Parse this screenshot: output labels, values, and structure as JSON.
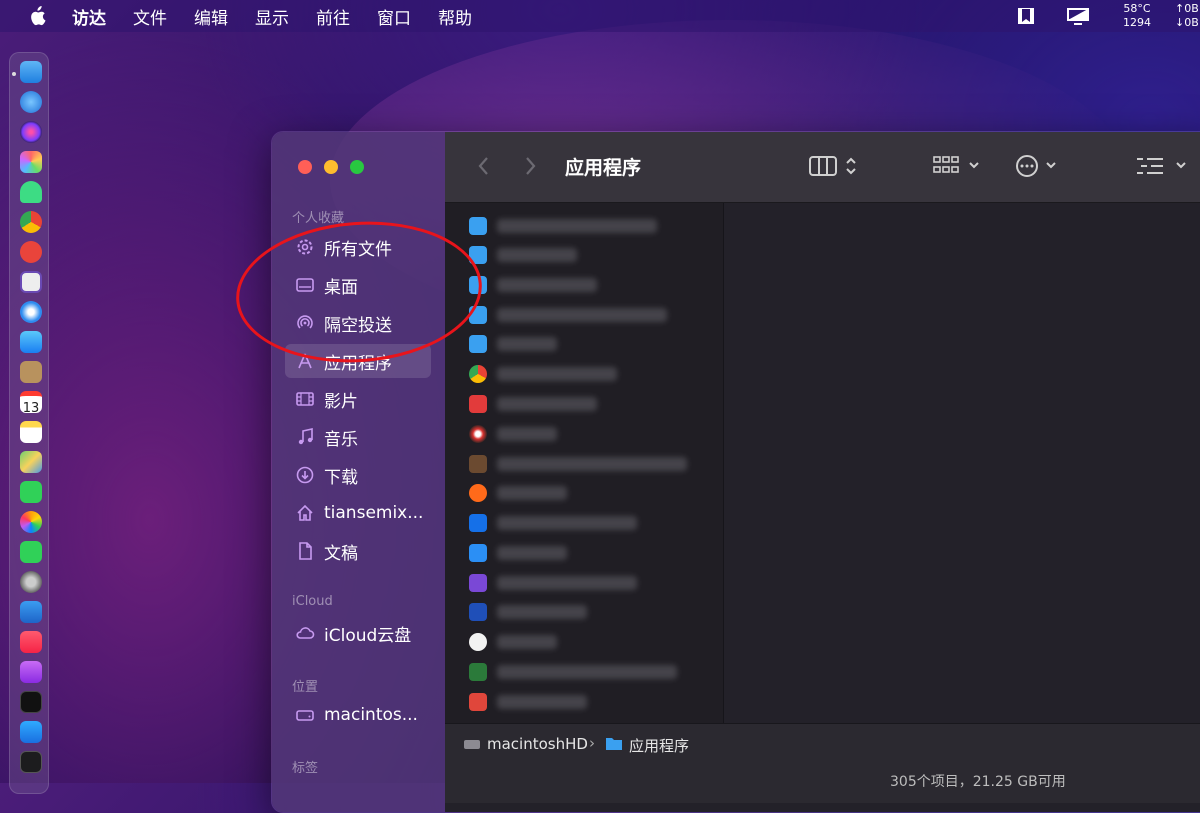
{
  "menubar": {
    "items": [
      "访达",
      "文件",
      "编辑",
      "显示",
      "前往",
      "窗口",
      "帮助"
    ],
    "temperature": "58°C",
    "fan": "1294",
    "net_up": "↑0B",
    "net_down": "↓0B"
  },
  "dock": {
    "icons": [
      "finder-icon",
      "app-store-icon",
      "siri-icon",
      "launchpad-icon",
      "android-studio-icon",
      "chrome-icon",
      "reminders-icon",
      "notes-icon",
      "safari-icon",
      "mail-icon",
      "contacts-icon",
      "calendar-icon",
      "stickies-icon",
      "maps-icon",
      "messages-icon",
      "photos-icon",
      "facetime-icon",
      "system-preferences-icon",
      "keynote-icon",
      "music-icon",
      "podcasts-icon",
      "tv-icon",
      "app-store-2-icon",
      "terminal-icon"
    ],
    "calendar_day": "13"
  },
  "finder": {
    "sidebar": {
      "favorites_header": "个人收藏",
      "favorites": [
        {
          "label": "所有文件",
          "icon": "gear-icon"
        },
        {
          "label": "桌面",
          "icon": "desktop-icon"
        },
        {
          "label": "隔空投送",
          "icon": "airdrop-icon"
        },
        {
          "label": "应用程序",
          "icon": "applications-icon",
          "selected": true
        },
        {
          "label": "影片",
          "icon": "film-icon"
        },
        {
          "label": "音乐",
          "icon": "music-note-icon"
        },
        {
          "label": "下载",
          "icon": "download-icon"
        },
        {
          "label": "tiansemix...",
          "icon": "home-icon"
        },
        {
          "label": "文稿",
          "icon": "document-icon"
        }
      ],
      "icloud_header": "iCloud",
      "icloud_item": "iCloud云盘",
      "locations_header": "位置",
      "location_item": "macintos...",
      "tags_header": "标签"
    },
    "toolbar": {
      "title": "应用程序"
    },
    "files_count_visible": 17,
    "pathbar": {
      "disk": "macintoshHD",
      "separator": "›",
      "folder": "应用程序"
    },
    "statusbar": {
      "text": "305个项目，21.25 GB可用"
    }
  },
  "colors": {
    "annotation_circle": "#e8141b",
    "accent_blue": "#3aa0f0"
  }
}
